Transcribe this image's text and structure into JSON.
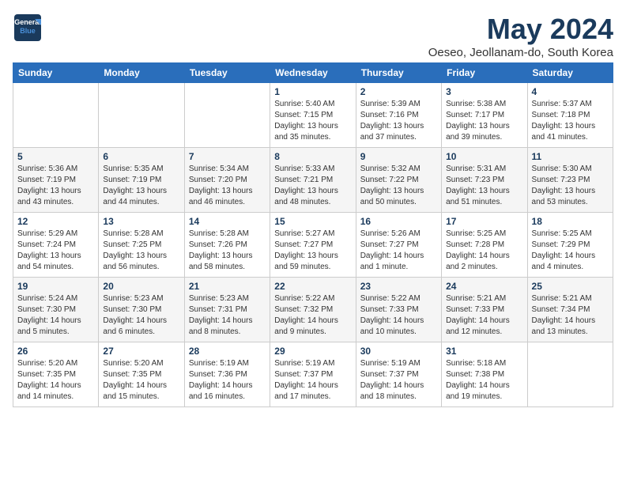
{
  "logo": {
    "line1": "General",
    "line2": "Blue"
  },
  "calendar": {
    "title": "May 2024",
    "subtitle": "Oeseo, Jeollanam-do, South Korea"
  },
  "headers": [
    "Sunday",
    "Monday",
    "Tuesday",
    "Wednesday",
    "Thursday",
    "Friday",
    "Saturday"
  ],
  "weeks": [
    [
      {
        "day": "",
        "info": ""
      },
      {
        "day": "",
        "info": ""
      },
      {
        "day": "",
        "info": ""
      },
      {
        "day": "1",
        "info": "Sunrise: 5:40 AM\nSunset: 7:15 PM\nDaylight: 13 hours\nand 35 minutes."
      },
      {
        "day": "2",
        "info": "Sunrise: 5:39 AM\nSunset: 7:16 PM\nDaylight: 13 hours\nand 37 minutes."
      },
      {
        "day": "3",
        "info": "Sunrise: 5:38 AM\nSunset: 7:17 PM\nDaylight: 13 hours\nand 39 minutes."
      },
      {
        "day": "4",
        "info": "Sunrise: 5:37 AM\nSunset: 7:18 PM\nDaylight: 13 hours\nand 41 minutes."
      }
    ],
    [
      {
        "day": "5",
        "info": "Sunrise: 5:36 AM\nSunset: 7:19 PM\nDaylight: 13 hours\nand 43 minutes."
      },
      {
        "day": "6",
        "info": "Sunrise: 5:35 AM\nSunset: 7:19 PM\nDaylight: 13 hours\nand 44 minutes."
      },
      {
        "day": "7",
        "info": "Sunrise: 5:34 AM\nSunset: 7:20 PM\nDaylight: 13 hours\nand 46 minutes."
      },
      {
        "day": "8",
        "info": "Sunrise: 5:33 AM\nSunset: 7:21 PM\nDaylight: 13 hours\nand 48 minutes."
      },
      {
        "day": "9",
        "info": "Sunrise: 5:32 AM\nSunset: 7:22 PM\nDaylight: 13 hours\nand 50 minutes."
      },
      {
        "day": "10",
        "info": "Sunrise: 5:31 AM\nSunset: 7:23 PM\nDaylight: 13 hours\nand 51 minutes."
      },
      {
        "day": "11",
        "info": "Sunrise: 5:30 AM\nSunset: 7:23 PM\nDaylight: 13 hours\nand 53 minutes."
      }
    ],
    [
      {
        "day": "12",
        "info": "Sunrise: 5:29 AM\nSunset: 7:24 PM\nDaylight: 13 hours\nand 54 minutes."
      },
      {
        "day": "13",
        "info": "Sunrise: 5:28 AM\nSunset: 7:25 PM\nDaylight: 13 hours\nand 56 minutes."
      },
      {
        "day": "14",
        "info": "Sunrise: 5:28 AM\nSunset: 7:26 PM\nDaylight: 13 hours\nand 58 minutes."
      },
      {
        "day": "15",
        "info": "Sunrise: 5:27 AM\nSunset: 7:27 PM\nDaylight: 13 hours\nand 59 minutes."
      },
      {
        "day": "16",
        "info": "Sunrise: 5:26 AM\nSunset: 7:27 PM\nDaylight: 14 hours\nand 1 minute."
      },
      {
        "day": "17",
        "info": "Sunrise: 5:25 AM\nSunset: 7:28 PM\nDaylight: 14 hours\nand 2 minutes."
      },
      {
        "day": "18",
        "info": "Sunrise: 5:25 AM\nSunset: 7:29 PM\nDaylight: 14 hours\nand 4 minutes."
      }
    ],
    [
      {
        "day": "19",
        "info": "Sunrise: 5:24 AM\nSunset: 7:30 PM\nDaylight: 14 hours\nand 5 minutes."
      },
      {
        "day": "20",
        "info": "Sunrise: 5:23 AM\nSunset: 7:30 PM\nDaylight: 14 hours\nand 6 minutes."
      },
      {
        "day": "21",
        "info": "Sunrise: 5:23 AM\nSunset: 7:31 PM\nDaylight: 14 hours\nand 8 minutes."
      },
      {
        "day": "22",
        "info": "Sunrise: 5:22 AM\nSunset: 7:32 PM\nDaylight: 14 hours\nand 9 minutes."
      },
      {
        "day": "23",
        "info": "Sunrise: 5:22 AM\nSunset: 7:33 PM\nDaylight: 14 hours\nand 10 minutes."
      },
      {
        "day": "24",
        "info": "Sunrise: 5:21 AM\nSunset: 7:33 PM\nDaylight: 14 hours\nand 12 minutes."
      },
      {
        "day": "25",
        "info": "Sunrise: 5:21 AM\nSunset: 7:34 PM\nDaylight: 14 hours\nand 13 minutes."
      }
    ],
    [
      {
        "day": "26",
        "info": "Sunrise: 5:20 AM\nSunset: 7:35 PM\nDaylight: 14 hours\nand 14 minutes."
      },
      {
        "day": "27",
        "info": "Sunrise: 5:20 AM\nSunset: 7:35 PM\nDaylight: 14 hours\nand 15 minutes."
      },
      {
        "day": "28",
        "info": "Sunrise: 5:19 AM\nSunset: 7:36 PM\nDaylight: 14 hours\nand 16 minutes."
      },
      {
        "day": "29",
        "info": "Sunrise: 5:19 AM\nSunset: 7:37 PM\nDaylight: 14 hours\nand 17 minutes."
      },
      {
        "day": "30",
        "info": "Sunrise: 5:19 AM\nSunset: 7:37 PM\nDaylight: 14 hours\nand 18 minutes."
      },
      {
        "day": "31",
        "info": "Sunrise: 5:18 AM\nSunset: 7:38 PM\nDaylight: 14 hours\nand 19 minutes."
      },
      {
        "day": "",
        "info": ""
      }
    ]
  ]
}
